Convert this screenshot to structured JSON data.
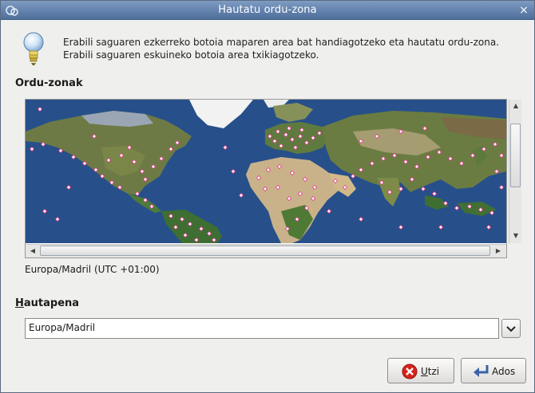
{
  "window": {
    "title": "Hautatu ordu-zona",
    "close_glyph": "×"
  },
  "info": {
    "icon": "lightbulb-icon",
    "line1": "Erabili saguaren ezkerreko botoia maparen area bat handiagotzeko eta hautatu ordu-zona.",
    "line2": "Erabili saguaren eskuineko botoia area txikiagotzeko."
  },
  "timezones": {
    "section_label": "Ordu-zonak",
    "hovered_label": "Europa/Madril (UTC +01:00)"
  },
  "selection": {
    "section_label_mnemonic": "H",
    "section_label_rest": "autapena",
    "selected_value": "Europa/Madril"
  },
  "buttons": {
    "cancel_mnemonic": "U",
    "cancel_rest": "tzi",
    "ok_mnemonic": "",
    "ok_label": "Ados"
  },
  "colors": {
    "ocean": "#27508a",
    "marker": "#e23a8a",
    "titlebar": "#6786b0"
  }
}
